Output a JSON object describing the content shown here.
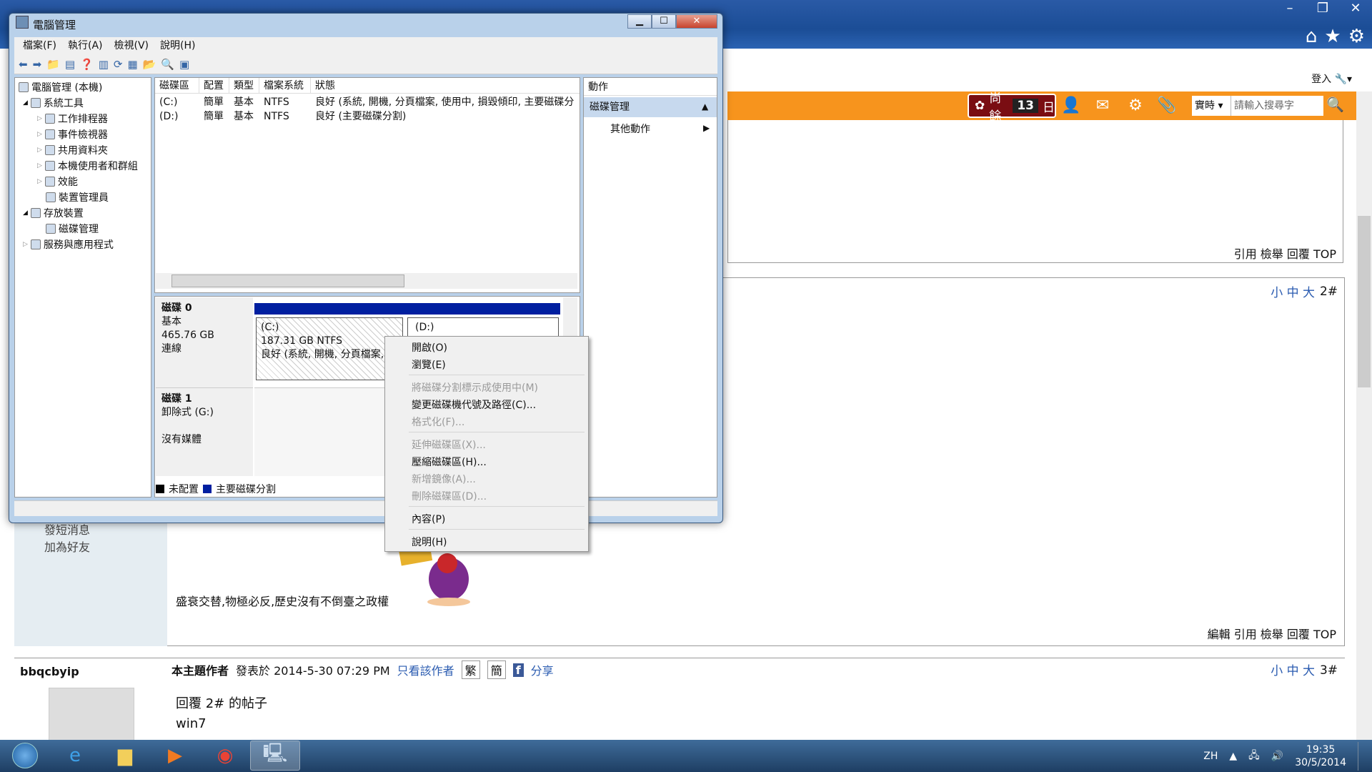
{
  "browser": {
    "login": "登入",
    "days_label": "尚餘",
    "days_value": "13",
    "days_unit": "日",
    "search_type": "實時 ▾",
    "search_placeholder": "請輸入搜尋字"
  },
  "forum": {
    "post1_actions": "引用 檢舉 回覆 TOP",
    "post2_sizes": "小 中 大",
    "post2_num": "2#",
    "send_msg": "發短消息",
    "add_friend": "加為好友",
    "motto": "盛衰交替,物極必反,歷史沒有不倒臺之政權",
    "post2_actions": "編輯 引用 檢舉 回覆 TOP",
    "post3_author": "bbqcbyip",
    "post3_badge": "本主題作者",
    "post3_date": "發表於 2014-5-30 07:29 PM",
    "post3_only_author": "只看該作者",
    "post3_trad": "繁",
    "post3_simp": "簡",
    "post3_share": "分享",
    "post3_sizes": "小 中 大",
    "post3_num": "3#",
    "post3_title": "回覆 2# 的帖子",
    "post3_text": "win7"
  },
  "taskbar": {
    "lang": "ZH",
    "time": "19:35",
    "date": "30/5/2014"
  },
  "cm": {
    "title": "電腦管理",
    "menu": [
      "檔案(F)",
      "執行(A)",
      "檢視(V)",
      "說明(H)"
    ],
    "tree": [
      "電腦管理 (本機)",
      "系統工具",
      "工作排程器",
      "事件檢視器",
      "共用資料夾",
      "本機使用者和群組",
      "效能",
      "裝置管理員",
      "存放裝置",
      "磁碟管理",
      "服務與應用程式"
    ],
    "columns": [
      "磁碟區",
      "配置",
      "類型",
      "檔案系統",
      "狀態"
    ],
    "volumes": [
      {
        "name": "(C:)",
        "layout": "簡單",
        "type": "基本",
        "fs": "NTFS",
        "status": "良好 (系統, 開機, 分頁檔案, 使用中, 損毀傾印, 主要磁碟分"
      },
      {
        "name": "(D:)",
        "layout": "簡單",
        "type": "基本",
        "fs": "NTFS",
        "status": "良好 (主要磁碟分割)"
      }
    ],
    "disk0": {
      "name": "磁碟 0",
      "type": "基本",
      "size": "465.76 GB",
      "state": "連線"
    },
    "disk1": {
      "name": "磁碟 1",
      "type": "卸除式 (G:)",
      "state": "沒有媒體"
    },
    "part_c": {
      "label": "(C:)",
      "size": "187.31 GB NTFS",
      "status": "良好 (系統, 開機, 分頁檔案,"
    },
    "part_d": {
      "label": "(D:)"
    },
    "legend_unalloc": "未配置",
    "legend_primary": "主要磁碟分割",
    "actions_header": "動作",
    "actions_section": "磁碟管理",
    "actions_other": "其他動作",
    "context_menu": [
      {
        "label": "開啟(O)"
      },
      {
        "label": "瀏覽(E)"
      },
      {
        "label": "將磁碟分割標示成使用中(M)"
      },
      {
        "label": "變更磁碟機代號及路徑(C)..."
      },
      {
        "label": "格式化(F)..."
      },
      {
        "label": "延伸磁碟區(X)..."
      },
      {
        "label": "壓縮磁碟區(H)..."
      },
      {
        "label": "新增鏡像(A)..."
      },
      {
        "label": "刪除磁碟區(D)..."
      },
      {
        "label": "內容(P)"
      },
      {
        "label": "說明(H)"
      }
    ]
  },
  "colors": {
    "orange": "#f7941d",
    "partition_blue": "#001fa0",
    "link": "#2a5bb0"
  }
}
